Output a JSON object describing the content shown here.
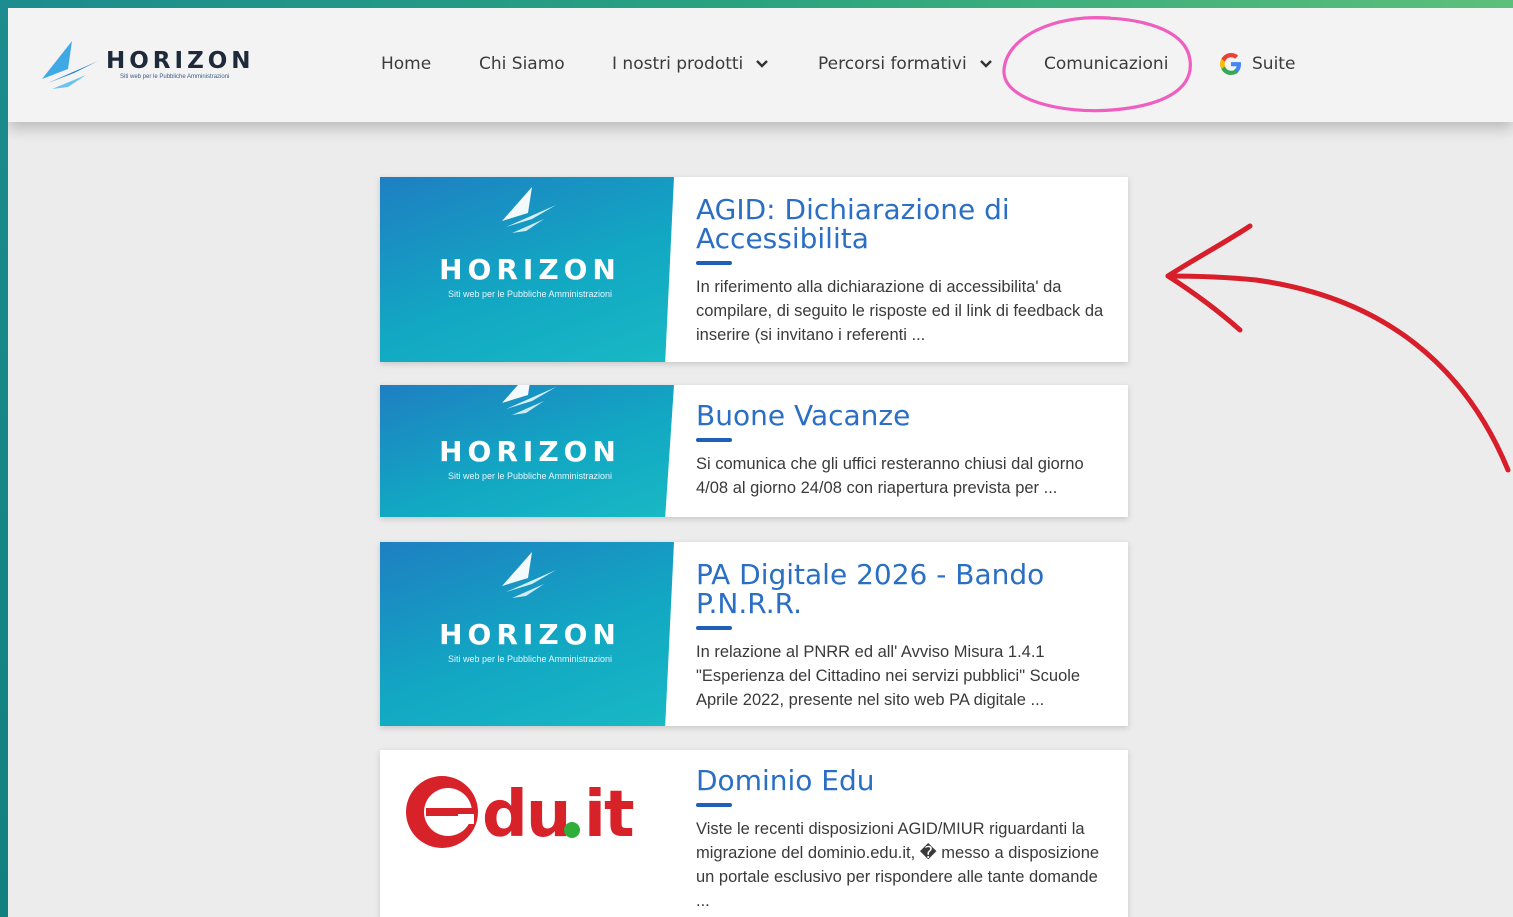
{
  "header": {
    "logo_word": "HORIZON",
    "logo_sub": "Siti web per le Pubbliche Amministrazioni",
    "nav": [
      {
        "label": "Home"
      },
      {
        "label": "Chi Siamo"
      },
      {
        "label": "I nostri prodotti",
        "has_dropdown": true
      },
      {
        "label": "Percorsi formativi",
        "has_dropdown": true
      },
      {
        "label": "Comunicazioni",
        "highlighted": true
      },
      {
        "label": "Suite",
        "icon": "google-g-icon"
      }
    ]
  },
  "cards": [
    {
      "image": "horizon-logo",
      "brand": "HORIZON",
      "brand_sub": "Siti web per le Pubbliche Amministrazioni",
      "title": "AGID: Dichiarazione di Accessibilita",
      "excerpt": "In riferimento alla dichiarazione di accessibilita' da compilare, di seguito le risposte ed il link di feedback da inserire (si invitano i referenti ..."
    },
    {
      "image": "horizon-logo",
      "brand": "HORIZON",
      "brand_sub": "Siti web per le Pubbliche Amministrazioni",
      "title": "Buone Vacanze",
      "excerpt": "Si comunica che gli uffici resteranno chiusi dal giorno 4/08 al giorno 24/08 con riapertura prevista per ..."
    },
    {
      "image": "horizon-logo",
      "brand": "HORIZON",
      "brand_sub": "Siti web per le Pubbliche Amministrazioni",
      "title": "PA Digitale 2026 - Bando P.N.R.R.",
      "excerpt": "In relazione al PNRR ed all' Avviso Misura 1.4.1 \"Esperienza del Cittadino nei servizi pubblici\" Scuole Aprile 2022, presente nel sito web PA digitale ..."
    },
    {
      "image": "edu-it-logo",
      "title": "Dominio Edu",
      "excerpt": "Viste le recenti disposizioni AGID/MIUR riguardanti la migrazione del dominio.edu.it, � messo a disposizione un portale esclusivo per rispondere alle tante domande ..."
    }
  ],
  "colors": {
    "frame": "#1a8f8a",
    "title_blue": "#2a6fc4",
    "accent_bar": "#1f5fb5",
    "annotation_pink": "#ef5fc0",
    "annotation_red": "#d81e2a"
  }
}
